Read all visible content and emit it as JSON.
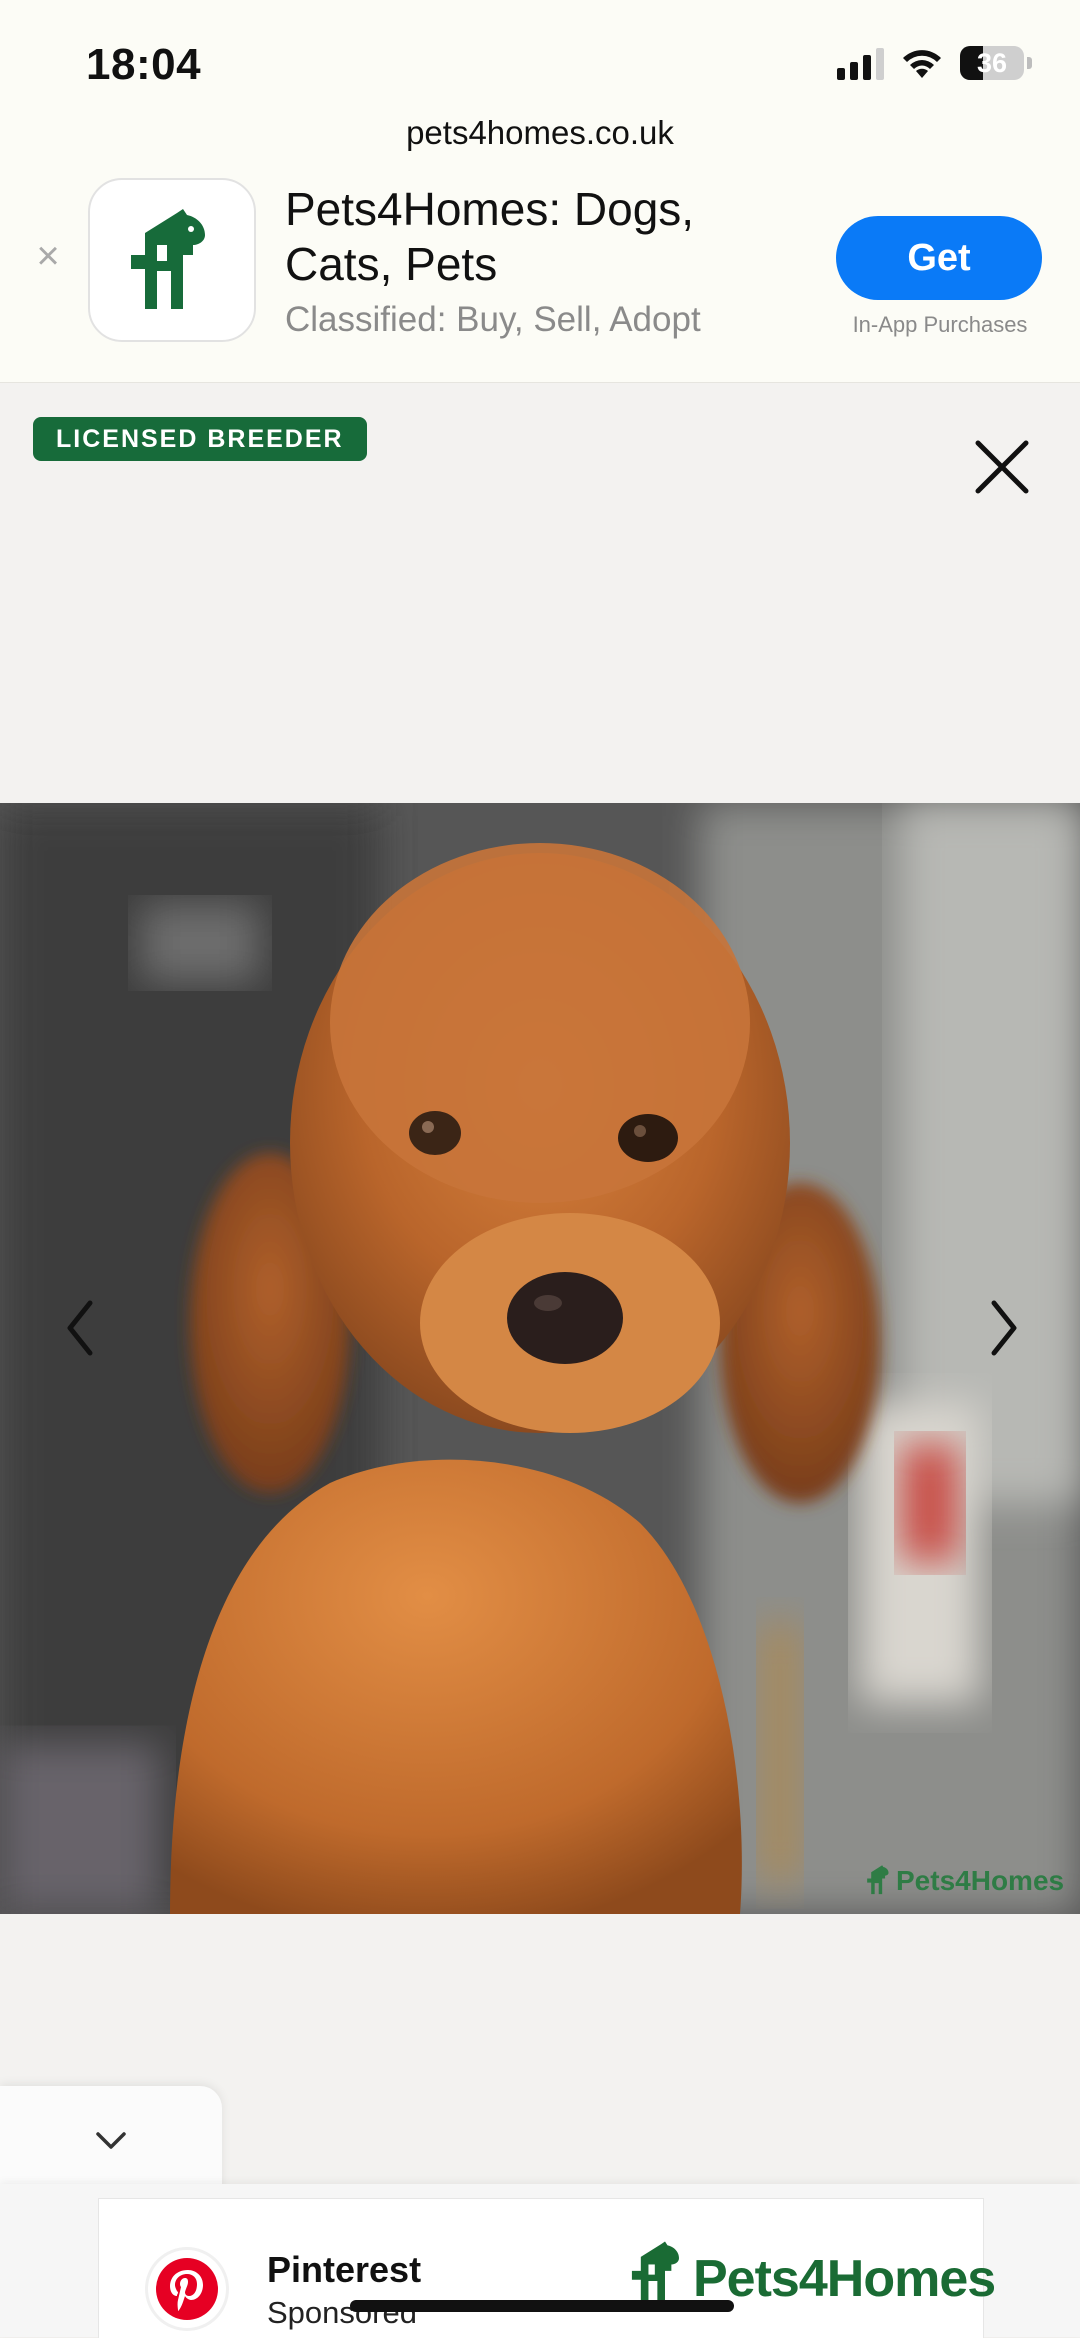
{
  "status_bar": {
    "time": "18:04",
    "battery": "36",
    "battery_level_percent": 36,
    "icons": [
      "cellular-signal-icon",
      "wifi-icon",
      "battery-icon"
    ]
  },
  "browser": {
    "url": "pets4homes.co.uk"
  },
  "app_banner": {
    "title": "Pets4Homes: Dogs, Cats, Pets",
    "subtitle": "Classified: Buy, Sell, Adopt",
    "get_label": "Get",
    "in_app_purchases": "In-App Purchases",
    "close_icon": "close-icon",
    "brand_color": "#176b3a",
    "button_color": "#0a7af7"
  },
  "gallery": {
    "badge": "LICENSED BREEDER",
    "badge_color": "#176b3a",
    "close_icon": "close-icon",
    "prev_icon": "chevron-left-icon",
    "next_icon": "chevron-right-icon",
    "image_subject": "red poodle dog photo",
    "watermark": "Pets4Homes"
  },
  "collapse": {
    "icon": "chevron-down-icon"
  },
  "ad": {
    "advertiser": "Pinterest",
    "label": "Sponsored",
    "brand": "Pets4Homes",
    "brand_color": "#1a6b34",
    "pinterest_color": "#e60023"
  }
}
